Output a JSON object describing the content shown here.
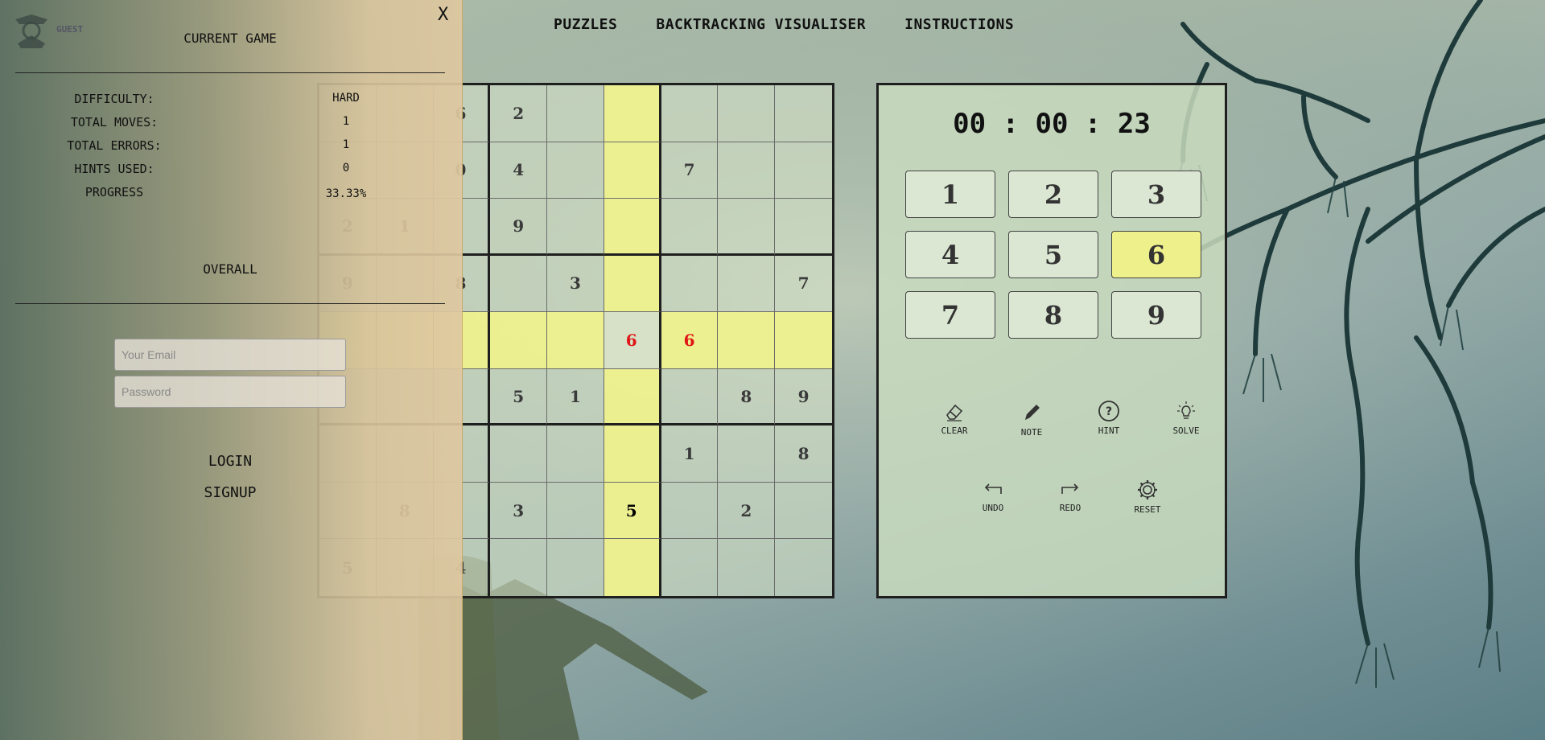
{
  "nav": {
    "puzzles": "PUZZLES",
    "visualiser": "BACKTRACKING VISUALISER",
    "instructions": "INSTRUCTIONS"
  },
  "board": {
    "cells": [
      [
        "",
        "",
        "6",
        "2",
        "",
        "",
        "",
        "",
        ""
      ],
      [
        "",
        "",
        "0",
        "4",
        "",
        "",
        "7",
        "",
        ""
      ],
      [
        "2",
        "1",
        "",
        "9",
        "",
        "",
        "",
        "",
        ""
      ],
      [
        "9",
        "",
        "8",
        "",
        "3",
        "",
        "",
        "",
        "7"
      ],
      [
        "",
        "",
        "",
        "",
        "",
        "6",
        "6",
        "",
        ""
      ],
      [
        "",
        "",
        "",
        "5",
        "1",
        "",
        "",
        "8",
        "9"
      ],
      [
        "",
        "",
        "",
        "",
        "",
        "",
        "1",
        "",
        "8"
      ],
      [
        "",
        "8",
        "",
        "3",
        "",
        "5",
        "",
        "2",
        ""
      ],
      [
        "5",
        "",
        "4",
        "",
        "",
        "",
        "",
        "",
        ""
      ]
    ],
    "selected_row": 4,
    "selected_col": 5,
    "error_cells": [
      [
        4,
        5
      ],
      [
        4,
        6
      ]
    ],
    "filled_cells": [
      [
        7,
        5
      ]
    ]
  },
  "panel": {
    "timer": "00 : 00 : 23",
    "numbers": [
      "1",
      "2",
      "3",
      "4",
      "5",
      "6",
      "7",
      "8",
      "9"
    ],
    "active_number": "6",
    "tools": {
      "clear": "CLEAR",
      "note": "NOTE",
      "hint": "HINT",
      "solve": "SOLVE",
      "undo": "UNDO",
      "redo": "REDO",
      "reset": "RESET"
    }
  },
  "drawer": {
    "close": "X",
    "guest": "GUEST",
    "current_game_title": "CURRENT GAME",
    "stats": {
      "difficulty_label": "DIFFICULTY:",
      "difficulty": "HARD",
      "moves_label": "TOTAL MOVES:",
      "moves": "1",
      "errors_label": "TOTAL ERRORS:",
      "errors": "1",
      "hints_label": "HINTS USED:",
      "hints": "0",
      "progress_label": "PROGRESS",
      "progress": "33.33%"
    },
    "overall_title": "OVERALL",
    "email_placeholder": "Your Email",
    "password_placeholder": "Password",
    "login": "LOGIN",
    "signup": "SIGNUP"
  },
  "colors": {
    "highlight": "#eef08c",
    "error": "#e01515",
    "drawer": "#dcc6a0"
  }
}
